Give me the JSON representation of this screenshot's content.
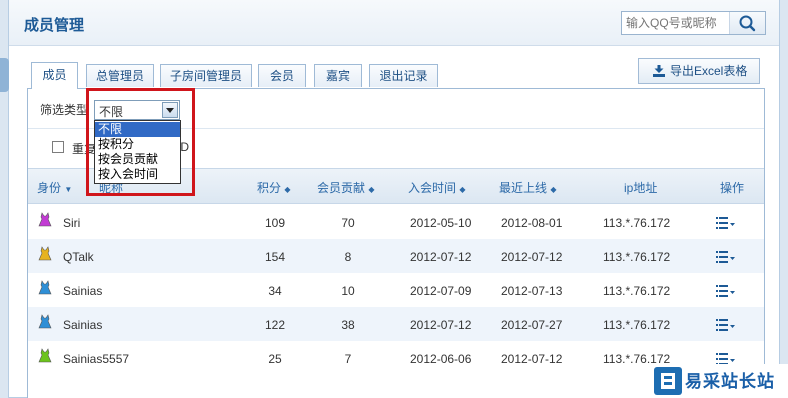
{
  "header": {
    "title": "成员管理",
    "search_placeholder": "输入QQ号或昵称"
  },
  "tabs": [
    {
      "label": "成员",
      "active": true
    },
    {
      "label": "总管理员"
    },
    {
      "label": "子房间管理员"
    },
    {
      "label": "会员"
    },
    {
      "label": "嘉宾"
    },
    {
      "label": "退出记录"
    }
  ],
  "toolbar": {
    "export_label": "导出Excel表格"
  },
  "filter": {
    "label": "筛选类型",
    "selected": "不限",
    "options": [
      "不限",
      "按积分",
      "按会员贡献",
      "按入会时间"
    ]
  },
  "repeat": {
    "label_left": "重复",
    "label_right": "ID"
  },
  "table": {
    "columns": [
      "身份",
      "昵称",
      "积分",
      "会员贡献",
      "入会时间",
      "最近上线",
      "ip地址",
      "操作"
    ],
    "rows": [
      {
        "nick": "Siri",
        "points": "109",
        "contribution": "70",
        "joined": "2012-05-10",
        "last_online": "2012-08-01",
        "ip": "113.*.76.172",
        "role_color": "#c23bd4"
      },
      {
        "nick": "QTalk",
        "points": "154",
        "contribution": "8",
        "joined": "2012-07-12",
        "last_online": "2012-07-12",
        "ip": "113.*.76.172",
        "role_color": "#e6b31e"
      },
      {
        "nick": "Sainias",
        "points": "34",
        "contribution": "10",
        "joined": "2012-07-09",
        "last_online": "2012-07-13",
        "ip": "113.*.76.172",
        "role_color": "#2f8fd6"
      },
      {
        "nick": "Sainias",
        "points": "122",
        "contribution": "38",
        "joined": "2012-07-12",
        "last_online": "2012-07-27",
        "ip": "113.*.76.172",
        "role_color": "#2f8fd6"
      },
      {
        "nick": "Sainias5557",
        "points": "25",
        "contribution": "7",
        "joined": "2012-06-06",
        "last_online": "2012-07-12",
        "ip": "113.*.76.172",
        "role_color": "#6cc41c"
      }
    ]
  },
  "watermark": {
    "text": "易采站长站"
  },
  "colors": {
    "accent": "#1d5a96",
    "highlight": "#d0151b",
    "selected": "#316ac5"
  }
}
